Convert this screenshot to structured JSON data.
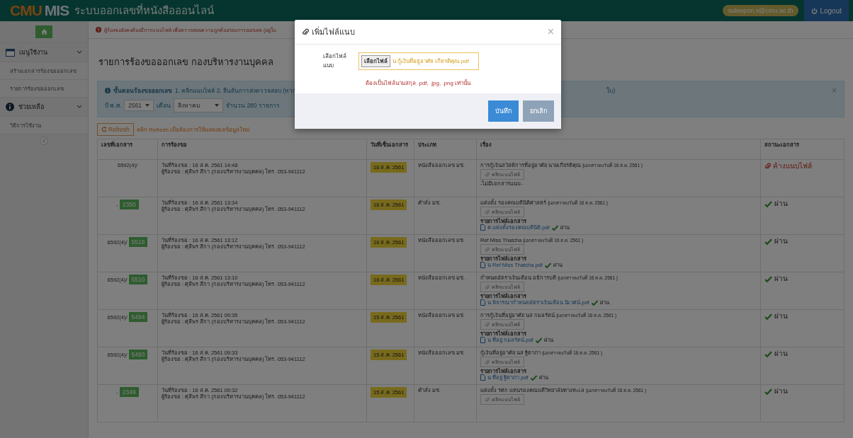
{
  "navbar": {
    "brand_a": "CMU",
    "brand_b": "MIS",
    "title": "ระบบออกเลขที่หนังสือออนไลน์",
    "user": "suleepon.s@cmu.ac.th",
    "logout": "Logout"
  },
  "sidebar": {
    "groups": [
      {
        "label": "เมนูใช้งาน",
        "expanded": true,
        "children": [
          "สร้างเอกสารร้องขอออกเลข",
          "รายการร้องขอออกเลข"
        ]
      },
      {
        "label": "ช่วยเหลือ",
        "expanded": true,
        "children": [
          "วิธีการใช้งาน"
        ]
      }
    ]
  },
  "notice": "ผู้ร้องขอยังคงต้องมีการแนบไฟล์ เพื่อตรวจสอบความถูกต้องก่อนการออกเลข (อยู่ใน",
  "page_title": "รายการร้องขอออกเลข กองบริหารงานบุคคล",
  "alert": {
    "heading": "ขั้นตอนร้องขอออกเลข",
    "text": "1. คลิกแนบไฟล์ 2. ยืนยันการส่งตรวจสอบ (หาก",
    "text_after": "ใบ)",
    "year_label": "ปี พ.ศ.",
    "year": "2561",
    "month_label": "เดือน",
    "month": "สิงหาคม",
    "count": "จำนวน 280 รายการ"
  },
  "refresh": {
    "label": "Refresh",
    "hint": "คลิก Refresh เมื่อต้องการให้แสดงผลข้อมูลใหม่"
  },
  "table": {
    "columns": [
      "เลขที่เอกสาร",
      "การร้องขอ",
      "วันที่เซ็นเอกสาร",
      "ประเภท",
      "เรื่อง",
      "สถานะเอกสาร"
    ],
    "rows": [
      {
        "doc": "6592(4)/",
        "request": "วันที่ร้องขอ : 16 ส.ค. 2561 14:48",
        "requester": "ผู้ร้องขอ : ศุลีพร สีกา (กองบริหารงานบุคคล) โทร. 053-941112",
        "date": "16 ส.ค. 2561",
        "type": "หนังสือออกเลข มช.",
        "subject": "การกู้เงินสวัสดิการที่อยู่อาศัย นายเกียรติคุณ",
        "note": "(เอกสารลงวันที่ 16 ส.ค. 2561 )",
        "attach": "คลิกแนบไฟล์",
        "no_files": "-ไม่มีเอกสารแนบ-",
        "status": {
          "kind": "pending",
          "label": "ค้างแนบไฟล์"
        }
      },
      {
        "doc": "-",
        "number": "2350",
        "request": "วันที่ร้องขอ : 16 ส.ค. 2561 13:34",
        "requester": "ผู้ร้องขอ : ศุลีพร สีกา (กองบริหารงานบุคคล) โทร. 053-941112",
        "date": "16 ส.ค. 2561",
        "type": "คำสั่ง มช.",
        "subject": "แต่งตั้ง รองคณบดีนิติศาสตร์",
        "note": "(เอกสารลงวันที่ 16 ส.ค. 2561 )",
        "attach": "คลิกแนบไฟล์",
        "files_heading": "รายการไฟล์เอกสาร",
        "files": [
          {
            "name": "ค แต่งตั้งรองคณบดีนิติ.pdf",
            "status": "ผ่าน"
          }
        ],
        "status": {
          "kind": "pass",
          "label": "ผ่าน"
        }
      },
      {
        "doc": "6592(4)/",
        "number": "5516",
        "request": "วันที่ร้องขอ : 16 ส.ค. 2561 13:12",
        "requester": "ผู้ร้องขอ : ศุลีพร สีกา (กองบริหารงานบุคคล) โทร. 053-941112",
        "date": "16 ส.ค. 2561",
        "type": "หนังสือออกเลข มช.",
        "subject": "Ref Miss Thatcha",
        "note": "(เอกสารลงวันที่ 16 ส.ค. 2561 )",
        "attach": "คลิกแนบไฟล์",
        "files_heading": "รายการไฟล์เอกสาร",
        "files": [
          {
            "name": "น Ref Miss Thatcha.pdf",
            "status": "ผ่าน"
          }
        ],
        "status": {
          "kind": "pass",
          "label": "ผ่าน"
        }
      },
      {
        "doc": "6592(4)/",
        "number": "5510",
        "request": "วันที่ร้องขอ : 16 ส.ค. 2561 13:10",
        "requester": "ผู้ร้องขอ : ศุลีพร สีกา (กองบริหารงานบุคคล) โทร. 053-941112",
        "date": "16 ส.ค. 2561",
        "type": "หนังสือออกเลข มช.",
        "subject": "กำหนดอัตราเงินเดือน อธิการบดี",
        "note": "(เอกสารลงวันที่ 16 ส.ค. 2561 )",
        "attach": "คลิกแนบไฟล์",
        "files_heading": "รายการไฟล์เอกสาร",
        "files": [
          {
            "name": "น พิจารณากำหนดอัตราเงินเดือน นิเวศน์.pdf",
            "status": "ผ่าน"
          }
        ],
        "status": {
          "kind": "pass",
          "label": "ผ่าน"
        }
      },
      {
        "doc": "6592(4)/",
        "number": "5494",
        "request": "วันที่ร้องขอ : 16 ส.ค. 2561 09:35",
        "requester": "ผู้ร้องขอ : ศุลีพร สีกา (กองบริหารงานบุคคล) โทร. 053-941112",
        "date": "15 ส.ค. 2561",
        "type": "หนังสือออกเลข มช.",
        "subject": "การกู้เงินที่อยู่อาศัย นส กมลรัตน์",
        "note": "(เอกสารลงวันที่ 16 ส.ค. 2561 )",
        "attach": "คลิกแนบไฟล์",
        "files_heading": "รายการไฟล์เอกสาร",
        "files": [
          {
            "name": "น ที่อยู่ กมลรัตน์.pdf",
            "status": "ผ่าน"
          }
        ],
        "status": {
          "kind": "pass",
          "label": "ผ่าน"
        }
      },
      {
        "doc": "6592(4)/",
        "number": "5493",
        "request": "วันที่ร้องขอ : 16 ส.ค. 2561 09:33",
        "requester": "ผู้ร้องขอ : ศุลีพร สีกา (กองบริหารงานบุคคล) โทร. 053-941112",
        "date": "15 ส.ค. 2561",
        "type": "หนังสือออกเลข มช.",
        "subject": "กู้เงินที่อยู่อาศัย นส ฐิตาภา",
        "note": "(เอกสารลงวันที่ 16 ส.ค. 2561 )",
        "attach": "คลิกแนบไฟล์",
        "files_heading": "รายการไฟล์เอกสาร",
        "files": [
          {
            "name": "น ที่อยู่ ฐิตาภา.pdf",
            "status": "ผ่าน"
          }
        ],
        "status": {
          "kind": "pass",
          "label": "ผ่าน"
        }
      },
      {
        "doc": "-",
        "number": "2349",
        "request": "วันที่ร้องขอ : 16 ส.ค. 2561 09:32",
        "requester": "ผู้ร้องขอ : ศุลีพร สีกา (กองบริหารงานบุคคล) โทร. 053-941112",
        "date": "15 ส.ค. 2561",
        "type": "คำสั่ง มช.",
        "subject": "แต่งตั้ง รศก แทนรองคณบดีวิทยาลัยทางทะเล",
        "note": "(เอกสารลงวันที่ 16 ส.ค. 2561 )",
        "attach": "คลิกแนบไฟล์",
        "status": {
          "kind": "pass",
          "label": "ผ่าน"
        }
      }
    ]
  },
  "modal": {
    "title": "เพิ่มไฟล์แนบ",
    "close": "×",
    "field_label": "เลือกไฟล์แนบ",
    "file_button": "เลือกไฟล์",
    "file_name": "น กู้เงินที่อยู่อาศัย เกียรติคุณ.pdf",
    "hint": "ต้องเป็นไฟล์นามสกุล .pdf, .jpg, .png เท่านั้น",
    "buttons": [
      {
        "label": "บันทึก",
        "kind": "primary",
        "disabled": false
      },
      {
        "label": "ยกเลิก",
        "kind": "default",
        "disabled": true
      }
    ]
  },
  "alert_close": "×"
}
